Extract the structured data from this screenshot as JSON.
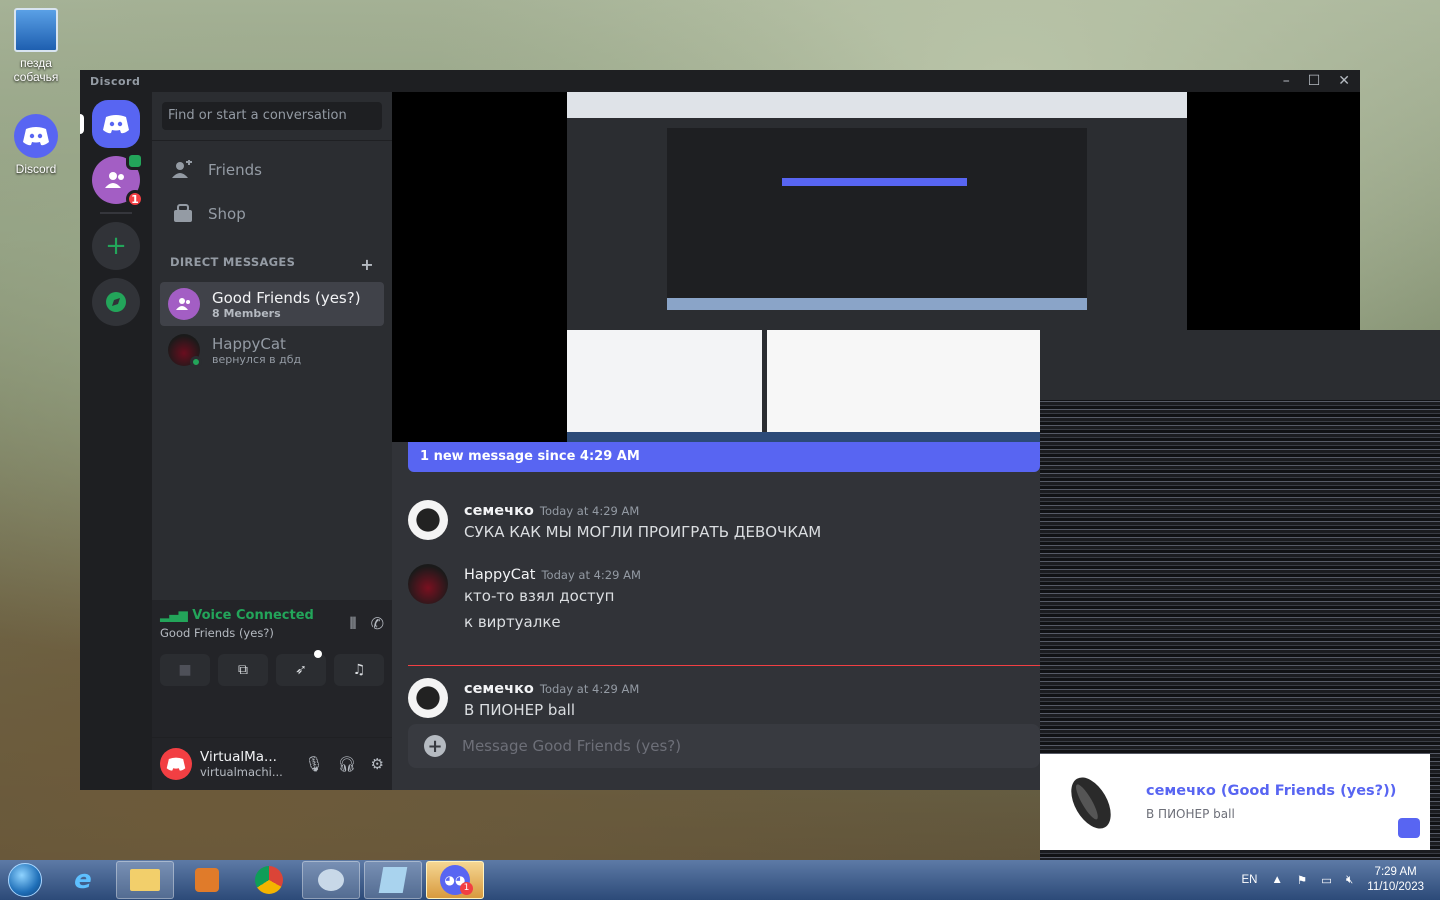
{
  "desktop": {
    "icons": [
      {
        "label": "пезда собачья",
        "icon": "computer-icon"
      },
      {
        "label": "Discord",
        "icon": "discord-icon"
      }
    ]
  },
  "window": {
    "title": "Discord",
    "controls": {
      "minimize": "–",
      "maximize": "☐",
      "close": "✕"
    }
  },
  "sidebar": {
    "search_placeholder": "Find or start a conversation",
    "nav": [
      {
        "label": "Friends",
        "icon": "friends-icon"
      },
      {
        "label": "Shop",
        "icon": "shop-icon"
      }
    ],
    "dm_header": "DIRECT MESSAGES",
    "dm_add": "+",
    "dms": [
      {
        "name": "Good Friends (yes?)",
        "sub": "8 Members",
        "active": true
      },
      {
        "name": "HappyCat",
        "sub": "вернулся в дбд",
        "active": false
      }
    ]
  },
  "guilds": {
    "group_badge": "1"
  },
  "voice": {
    "status": "Voice Connected",
    "channel": "Good Friends (yes?)"
  },
  "user": {
    "name": "VirtualMa...",
    "tag": "virtualmachi..."
  },
  "chat": {
    "new_messages_bar": "1 new message since 4:29 AM",
    "messages": [
      {
        "author": "семечко",
        "time": "Today at 4:29 AM",
        "lines": [
          "СУКА КАК МЫ МОГЛИ ПРОИГРАТЬ ДЕВОЧКАМ"
        ]
      },
      {
        "author": "HappyCat",
        "time": "Today at 4:29 AM",
        "lines": [
          "кто-то взял доступ",
          "к виртуалке"
        ]
      },
      {
        "author": "семечко",
        "time": "Today at 4:29 AM",
        "lines": [
          "В ПИОНЕР ball"
        ]
      }
    ],
    "composer_placeholder": "Message Good Friends (yes?)"
  },
  "notification": {
    "title": "семечко (Good Friends (yes?))",
    "body": "В ПИОНЕР ball"
  },
  "taskbar": {
    "language": "EN",
    "time": "7:29 AM",
    "date": "11/10/2023",
    "discord_badge": "1"
  },
  "colors": {
    "blurple": "#5865f2",
    "green": "#23a55a",
    "red": "#f23f43"
  }
}
